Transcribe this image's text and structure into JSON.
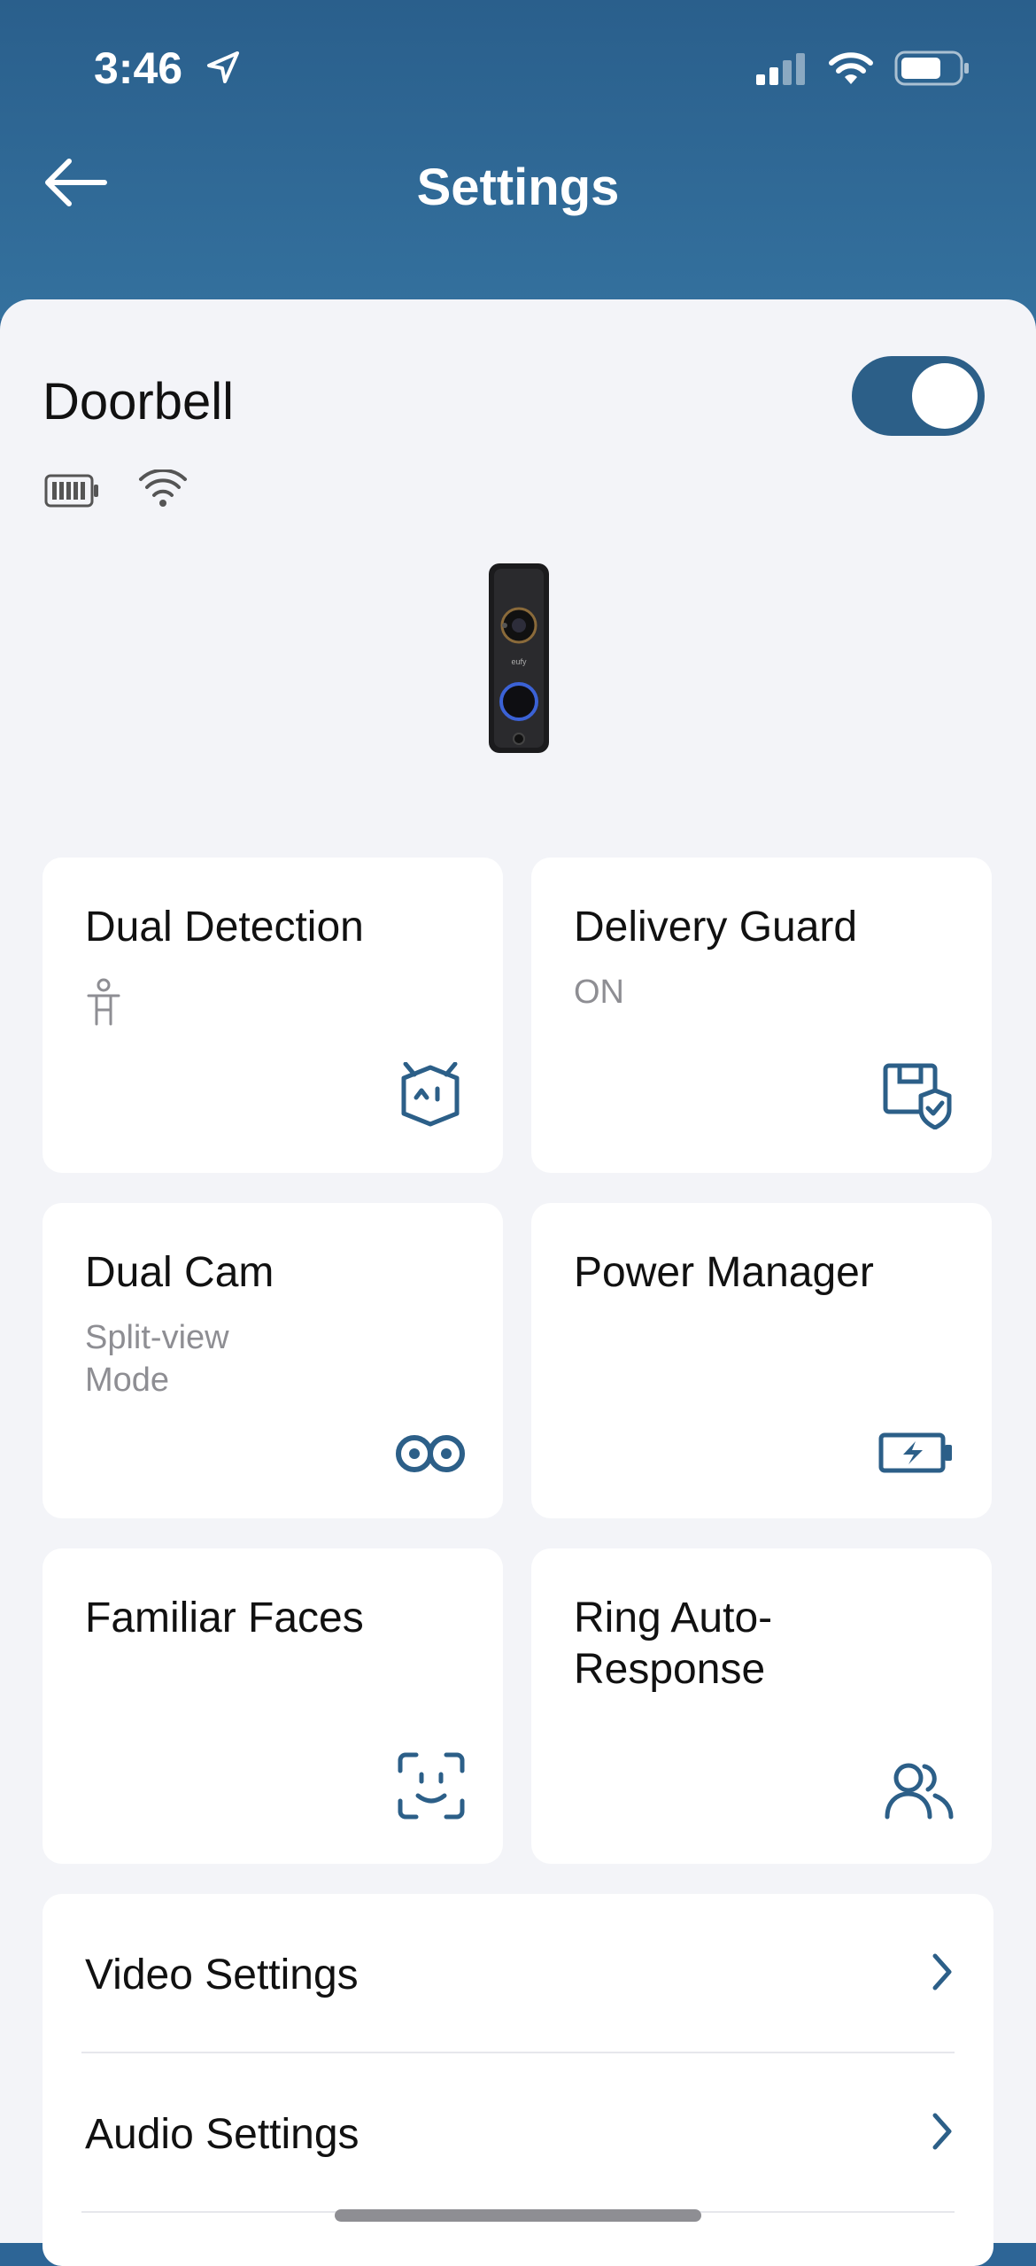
{
  "status_bar": {
    "time": "3:46"
  },
  "header": {
    "title": "Settings"
  },
  "device": {
    "name": "Doorbell",
    "enabled": true
  },
  "cards": [
    {
      "title": "Dual Detection",
      "subtitle": "",
      "icon": "face-box-icon"
    },
    {
      "title": "Delivery Guard",
      "subtitle": "ON",
      "icon": "package-shield-icon"
    },
    {
      "title": "Dual Cam",
      "subtitle": "Split-view\nMode",
      "icon": "dual-lens-icon"
    },
    {
      "title": "Power Manager",
      "subtitle": "",
      "icon": "battery-charging-icon"
    },
    {
      "title": "Familiar Faces",
      "subtitle": "",
      "icon": "face-scan-icon"
    },
    {
      "title": "Ring Auto-\nResponse",
      "subtitle": "",
      "icon": "people-icon"
    }
  ],
  "list": [
    {
      "label": "Video Settings"
    },
    {
      "label": "Audio Settings"
    }
  ],
  "colors": {
    "accent": "#2c5f88",
    "header": "#2d6596",
    "background": "#f3f4f8"
  }
}
